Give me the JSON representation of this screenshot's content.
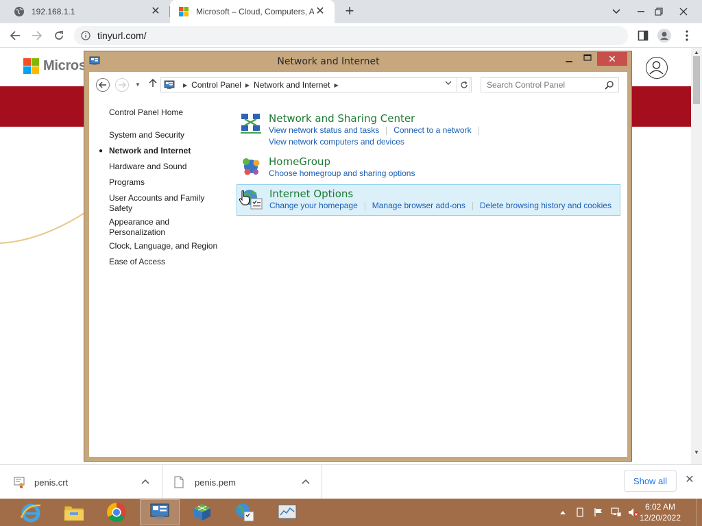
{
  "browser": {
    "tabs": [
      {
        "title": "192.168.1.1",
        "active": false
      },
      {
        "title": "Microsoft – Cloud, Computers, Apps & Gaming",
        "active": true
      }
    ],
    "url": "tinyurl.com/"
  },
  "webpage": {
    "logo_text": "Microsoft",
    "banner_color": "#a50e1d"
  },
  "window": {
    "title": "Network and Internet",
    "breadcrumb": [
      "Control Panel",
      "Network and Internet"
    ],
    "search_placeholder": "Search Control Panel"
  },
  "left_nav": {
    "items": [
      {
        "label": "Control Panel Home"
      },
      {
        "label": "System and Security"
      },
      {
        "label": "Network and Internet",
        "active": true
      },
      {
        "label": "Hardware and Sound"
      },
      {
        "label": "Programs"
      },
      {
        "label": "User Accounts and Family Safety"
      },
      {
        "label": "Appearance and Personalization"
      },
      {
        "label": "Clock, Language, and Region"
      },
      {
        "label": "Ease of Access"
      }
    ]
  },
  "categories": [
    {
      "title": "Network and Sharing Center",
      "icon": "network-sharing-icon",
      "links": [
        "View network status and tasks",
        "Connect to a network",
        "View network computers and devices"
      ]
    },
    {
      "title": "HomeGroup",
      "icon": "homegroup-icon",
      "links": [
        "Choose homegroup and sharing options"
      ]
    },
    {
      "title": "Internet Options",
      "icon": "internet-options-icon",
      "links": [
        "Change your homepage",
        "Manage browser add-ons",
        "Delete browsing history and cookies"
      ],
      "hovered": true
    }
  ],
  "downloads": {
    "items": [
      {
        "name": "penis.crt"
      },
      {
        "name": "penis.pem"
      }
    ],
    "show_all": "Show all"
  },
  "taskbar": {
    "clock_time": "6:02 AM",
    "clock_date": "12/20/2022",
    "color": "#a06d48"
  }
}
